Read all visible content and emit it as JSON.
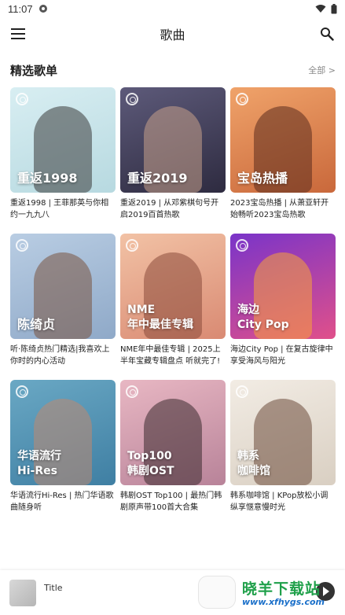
{
  "status_bar": {
    "time": "11:07"
  },
  "app_bar": {
    "title": "歌曲"
  },
  "section": {
    "heading": "精选歌单",
    "more": "全部 >"
  },
  "playlists": [
    {
      "cover_text": "重返1998",
      "caption": "重返1998 | 王菲那英与你相约一九九八",
      "colors": [
        "#d8eef2",
        "#b7d9e0"
      ],
      "figure": "#3a3a3a"
    },
    {
      "cover_text": "重返2019",
      "caption": "重返2019 | 从邓紫棋句号开启2019百首热歌",
      "colors": [
        "#5d5a7a",
        "#2e2b40"
      ],
      "figure": "#c7a08b"
    },
    {
      "cover_text": "宝岛热播",
      "caption": "2023宝岛热播 | 从萧亚轩开始畅听2023宝岛热歌",
      "colors": [
        "#f0a36a",
        "#c9683b"
      ],
      "figure": "#5b2c1d"
    },
    {
      "cover_text": "陈绮贞",
      "caption": "听·陈绮贞热门精选|我喜欢上你时的内心活动",
      "colors": [
        "#b9cde3",
        "#8fa9c8"
      ],
      "figure": "#7a5440"
    },
    {
      "cover_text": "NME\n年中最佳专辑",
      "caption": "NME年中最佳专辑 | 2025上半年宝藏专辑盘点 听就完了!",
      "colors": [
        "#f2c2a5",
        "#d98a73"
      ],
      "figure": "#8a4a3a"
    },
    {
      "cover_text": "海边\nCity Pop",
      "caption": "海边City Pop | 在复古旋律中享受海风与阳光",
      "colors": [
        "#7a34c9",
        "#e0508a"
      ],
      "figure": "#f7a23a"
    },
    {
      "cover_text": "华语流行\nHi-Res",
      "caption": "华语流行Hi-Res | 热门华语歌曲随身听",
      "colors": [
        "#6aa8c4",
        "#3f7fa3"
      ],
      "figure": "#c08870"
    },
    {
      "cover_text": "Top100\n韩剧OST",
      "caption": "韩剧OST Top100 | 最热门韩剧原声带100首大合集",
      "colors": [
        "#e8b7c3",
        "#b88399"
      ],
      "figure": "#3a2a2e"
    },
    {
      "cover_text": "韩系\n咖啡馆",
      "caption": "韩系咖啡馆 | KPop放松小调 纵享惬意慢时光",
      "colors": [
        "#f2ece4",
        "#d9cfc2"
      ],
      "figure": "#6b4a3a"
    }
  ],
  "player": {
    "title": "Title"
  },
  "watermark": {
    "title": "晓羊下载站",
    "url": "www.xfhygs.com"
  }
}
